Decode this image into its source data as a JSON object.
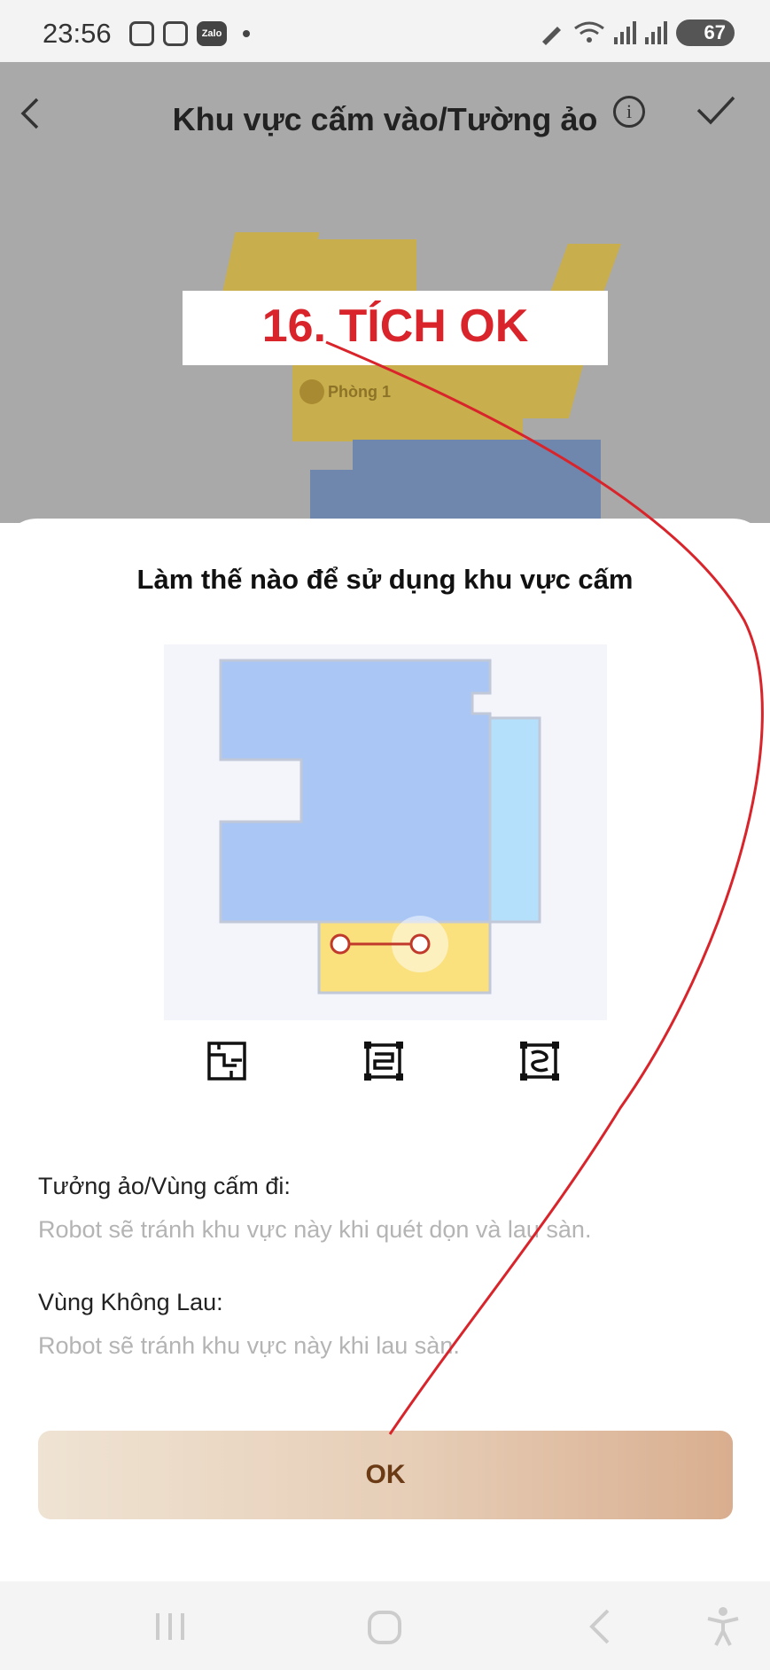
{
  "status_bar": {
    "time": "23:56",
    "zalo_label": "Zalo",
    "battery": "67"
  },
  "header": {
    "title": "Khu vực cấm vào/Tường ảo",
    "info_glyph": "i"
  },
  "map": {
    "room_label": "Phòng 1"
  },
  "annotation": {
    "text": "16. TÍCH OK",
    "color": "#d8242a"
  },
  "sheet": {
    "title": "Làm thế nào để sử dụng khu vực cấm",
    "tools": [
      "virtual-wall-tool-icon",
      "no-go-zone-tool-icon",
      "no-mop-zone-tool-icon"
    ],
    "sections": [
      {
        "title": "Tưởng ảo/Vùng cấm đi:",
        "body": "Robot sẽ tránh khu vực này khi quét dọn và lau sàn."
      },
      {
        "title": "Vùng Không Lau:",
        "body": "Robot sẽ tránh khu vực này khi lau sàn."
      }
    ],
    "ok_label": "OK"
  },
  "colors": {
    "map_yellow": "#c9ae4d",
    "map_blue": "#6f86ad",
    "illus_blue": "#a9c6f5",
    "illus_lightblue": "#b5e0fb",
    "illus_yellow": "#fbe07e",
    "ok_text": "#6b3b16"
  }
}
